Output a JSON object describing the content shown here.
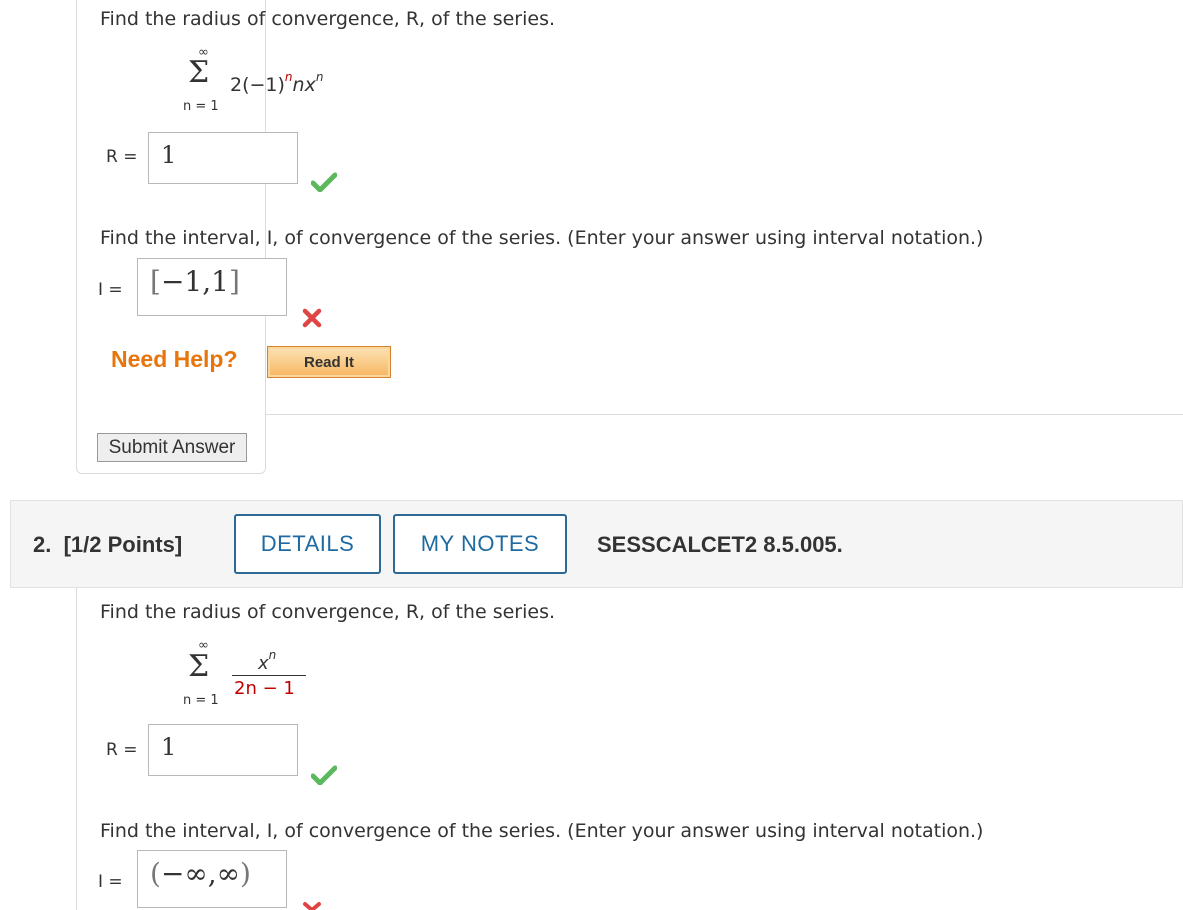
{
  "question1": {
    "prompt_radius": "Find the radius of convergence, R, of the series.",
    "series": {
      "upper": "∞",
      "sigma": "Σ",
      "lower": "n = 1",
      "coef": "2(−1)",
      "exp1": "n",
      "mid": "nx",
      "exp2": "n"
    },
    "r_label": "R =",
    "r_value": "1",
    "r_status": "correct",
    "prompt_interval": "Find the interval, I, of convergence of the series. (Enter your answer using interval notation.)",
    "i_label": "I =",
    "i_value": {
      "open": "[",
      "body": "−1,1",
      "close": "]"
    },
    "i_status": "incorrect",
    "need_help": "Need Help?",
    "read_it": "Read It",
    "submit": "Submit Answer"
  },
  "question2": {
    "number": "2.",
    "points": "[1/2 Points]",
    "details": "DETAILS",
    "my_notes": "MY NOTES",
    "code": "SESSCALCET2 8.5.005.",
    "prompt_radius": "Find the radius of convergence, R, of the series.",
    "series": {
      "upper": "∞",
      "sigma": "Σ",
      "lower": "n = 1",
      "numerator_base": "x",
      "numerator_exp": "n",
      "denominator": "2n − 1"
    },
    "r_label": "R =",
    "r_value": "1",
    "r_status": "correct",
    "prompt_interval": "Find the interval, I, of convergence of the series. (Enter your answer using interval notation.)",
    "i_label": "I =",
    "i_value": {
      "open": "(",
      "body": "−∞,∞",
      "close": ")"
    }
  },
  "colors": {
    "correct": "#5cb85c",
    "incorrect": "#e04545",
    "accent": "#1f6aa1",
    "help": "#e8750b"
  }
}
